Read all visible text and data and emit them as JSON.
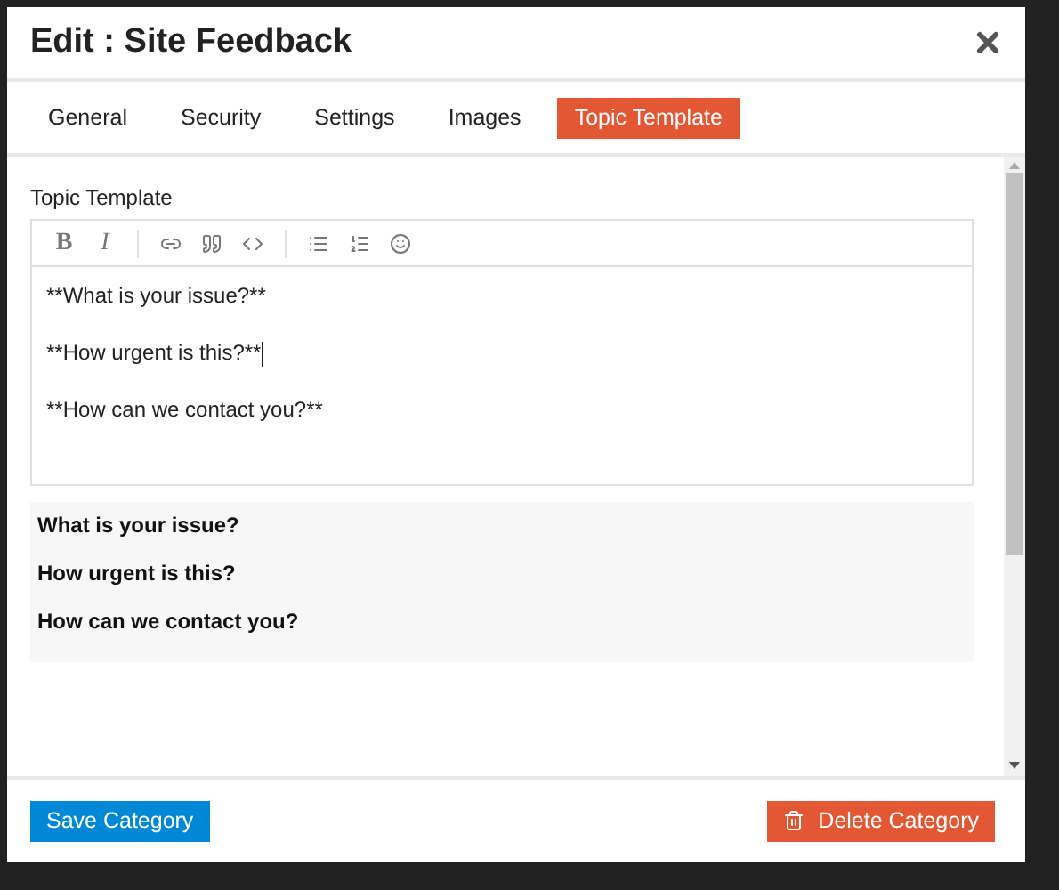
{
  "dialog": {
    "title": "Edit : Site Feedback"
  },
  "tabs": [
    {
      "label": "General",
      "selected": false
    },
    {
      "label": "Security",
      "selected": false
    },
    {
      "label": "Settings",
      "selected": false
    },
    {
      "label": "Images",
      "selected": false
    },
    {
      "label": "Topic Template",
      "selected": true
    }
  ],
  "field_label": "Topic Template",
  "toolbar": [
    {
      "kind": "bold",
      "label": "B"
    },
    {
      "kind": "italic",
      "label": "I"
    },
    {
      "kind": "divider"
    },
    {
      "kind": "link"
    },
    {
      "kind": "quote"
    },
    {
      "kind": "code"
    },
    {
      "kind": "divider"
    },
    {
      "kind": "bullets"
    },
    {
      "kind": "numbers"
    },
    {
      "kind": "emoji"
    }
  ],
  "editor_lines": [
    {
      "text": "**What is your issue?**",
      "cursor": false
    },
    {
      "text": "**How urgent is this?**",
      "cursor": true
    },
    {
      "text": "**How can we contact you?**",
      "cursor": false
    }
  ],
  "preview_lines": [
    "What is your issue?",
    "How urgent is this?",
    "How can we contact you?"
  ],
  "buttons": {
    "save": "Save Category",
    "delete": "Delete Category"
  }
}
